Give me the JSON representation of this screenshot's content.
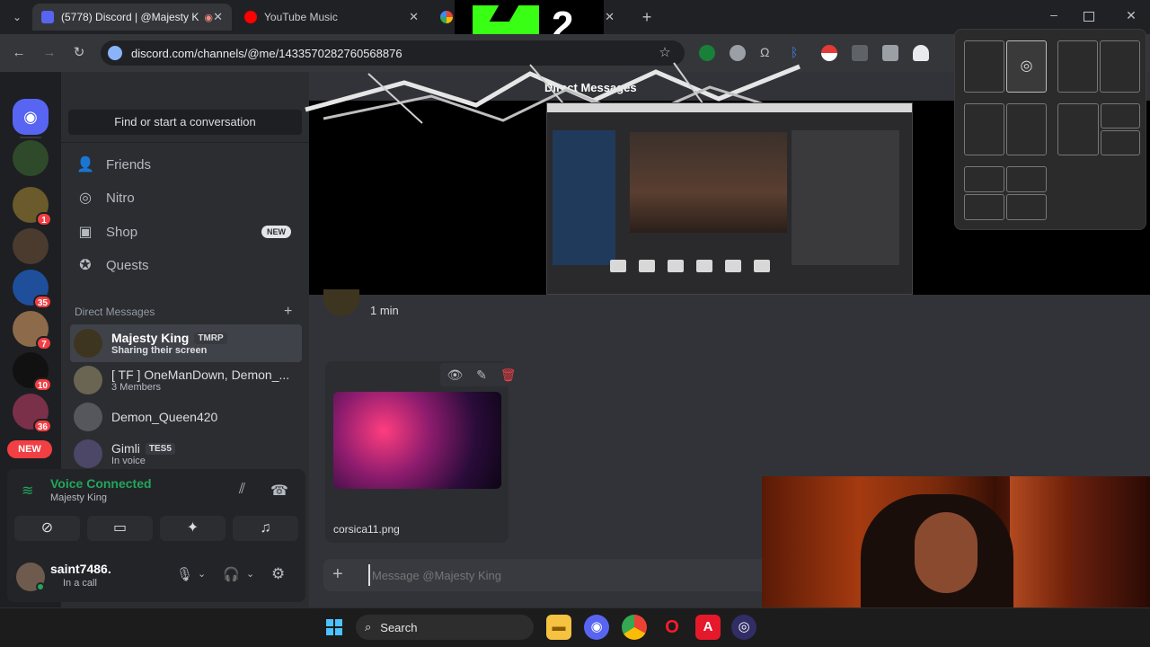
{
  "browser": {
    "tabs": [
      {
        "label": "(5778) Discord | @Majesty K"
      },
      {
        "label": "YouTube Music"
      }
    ],
    "url": "discord.com/channels/@me/1433570282760568876"
  },
  "overlay": {
    "counter_label": "2"
  },
  "rail": {
    "badges": [
      "1",
      "35",
      "7",
      "10",
      "36"
    ],
    "new_label": "NEW"
  },
  "sidebar": {
    "search_label": "Find or start a conversation",
    "nav": [
      {
        "label": "Friends",
        "icon": "friends-icon"
      },
      {
        "label": "Nitro",
        "icon": "nitro-icon"
      },
      {
        "label": "Shop",
        "icon": "shop-icon",
        "badge": "NEW"
      },
      {
        "label": "Quests",
        "icon": "quests-icon"
      }
    ],
    "dm_header": "Direct Messages",
    "dms": [
      {
        "name": "Majesty King",
        "tag": "TMRP",
        "sub": "Sharing their screen"
      },
      {
        "name": "[ TF ] OneManDown, Demon_...",
        "sub": "3 Members"
      },
      {
        "name": "Demon_Queen420",
        "sub": ""
      },
      {
        "name": "Gimli",
        "tag": "TES5",
        "sub": "In voice"
      }
    ]
  },
  "voice": {
    "status": "Voice Connected",
    "channel": "Majesty King"
  },
  "user": {
    "name": "saint7486.",
    "status": "In a call"
  },
  "main": {
    "stream_title": "Direct Messages",
    "message_time": "1 min",
    "attachment_name": "corsica11.png",
    "composer_placeholder": "Message @Majesty King"
  },
  "taskbar": {
    "search_label": "Search"
  },
  "colors": {
    "discord_blurple": "#5865f2",
    "voice_green": "#23a55a",
    "badge_red": "#f23f43",
    "overlay_green": "#39ff14"
  }
}
